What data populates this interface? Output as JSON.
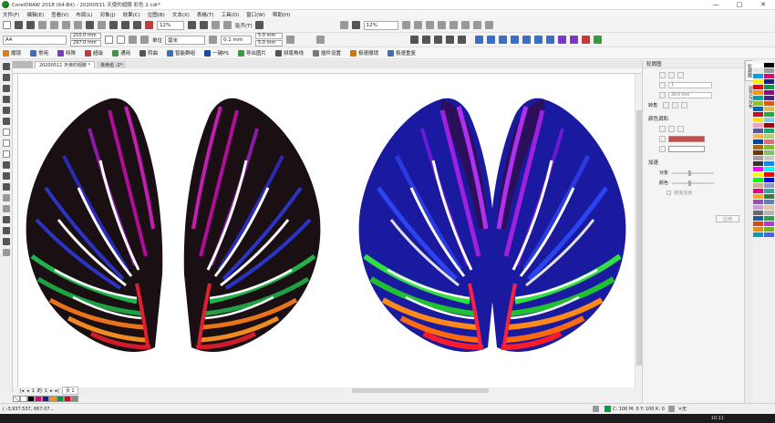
{
  "window": {
    "title": "CorelDRAW 2018 (64-Bit) - 20200511 天使的翅膀 彩色 2.cdr*",
    "minimize": "—",
    "maximize": "□",
    "close": "✕"
  },
  "menu": [
    "文件(F)",
    "编辑(E)",
    "查看(V)",
    "布局(L)",
    "对象(J)",
    "效果(C)",
    "位图(B)",
    "文本(X)",
    "表格(T)",
    "工具(O)",
    "窗口(W)",
    "帮助(H)"
  ],
  "toolbar1": {
    "zoom": "12%",
    "zoom_right": "12%",
    "snap_label": "贴齐(T)"
  },
  "toolbar2": {
    "page_size": "A4",
    "width": "210.0 mm",
    "height": "297.0 mm",
    "units_label": "单位",
    "units": "毫米",
    "nudge": "0.1 mm",
    "dup_x": "5.0 mm",
    "dup_y": "5.0 mm"
  },
  "plugins": [
    {
      "label": "魔镜",
      "icon": "mirror-icon",
      "color": "#e07a1a"
    },
    {
      "label": "常用",
      "icon": "common-icon",
      "color": "#3a6fc4"
    },
    {
      "label": "特殊",
      "icon": "special-icon",
      "color": "#7a3ac4"
    },
    {
      "label": "超级",
      "icon": "super-icon",
      "color": "#c43a3a"
    },
    {
      "label": "通用",
      "icon": "general-icon",
      "color": "#3a9b3a"
    },
    {
      "label": "转曲",
      "icon": "curve-icon",
      "color": "#555555"
    },
    {
      "label": "智能群组",
      "icon": "smart-group-icon",
      "color": "#3a6fc4"
    },
    {
      "label": "一键PS",
      "icon": "ps-icon",
      "color": "#1a4a9a"
    },
    {
      "label": "导出图片",
      "icon": "export-icon",
      "color": "#3a9b3a"
    },
    {
      "label": "拼版角线",
      "icon": "cropmark-icon",
      "color": "#555555"
    },
    {
      "label": "插件设置",
      "icon": "settings-icon",
      "color": "#777777"
    },
    {
      "label": "极速撤销",
      "icon": "undo-icon",
      "color": "#c47a1a"
    },
    {
      "label": "极速重复",
      "icon": "redo-icon",
      "color": "#3a6fc4"
    }
  ],
  "doc_tabs": {
    "active": "20200511 天使的翅膀 *",
    "other": "未命名 -2*"
  },
  "page_nav": {
    "current": "1",
    "of_label": "的",
    "total": "1",
    "page_tab": "页 1"
  },
  "status": {
    "coords": "( -3,937.537, 667.07...",
    "fill_label": "C: 100 M: 0 Y: 100 K: 0",
    "outline_label": "无",
    "clock": "10:11"
  },
  "dock": {
    "title": "轮廓图",
    "steps_value": "1",
    "offset_value": "30.0 mm",
    "corner_label": "转角",
    "color_section": "颜色调和",
    "accel_section": "加速",
    "object_label": "对象",
    "color_label": "颜色",
    "link_label": "链接加速",
    "apply": "应用",
    "outline_color": "#c0504d",
    "fill_color": "#ffffff"
  },
  "vertical_tabs": [
    "轮廓图",
    "对齐与分布"
  ],
  "swatch_colors": [
    "#ffffff",
    "#000000",
    "#e6007e",
    "#1d2088",
    "#f39800",
    "#009944",
    "#e60012",
    "#888888"
  ],
  "palette_colors": [
    "#ffffff",
    "#000000",
    "#e5e5e5",
    "#999999",
    "#00a0e9",
    "#e6007e",
    "#fff100",
    "#1d2088",
    "#e60012",
    "#009944",
    "#f39800",
    "#920783",
    "#00a29a",
    "#601986",
    "#8fc31f",
    "#ea5514",
    "#0068b7",
    "#d7c447",
    "#c30d23",
    "#22ac38",
    "#ffe100",
    "#7ecef4",
    "#f19ec2",
    "#a40000",
    "#5f52a0",
    "#13ae67",
    "#f8b551",
    "#b3d465",
    "#00479d",
    "#eb6877",
    "#ac6a00",
    "#7fbe26",
    "#6a3906",
    "#80c269",
    "#a0a0a0",
    "#c9caca",
    "#333333",
    "#0090ff",
    "#ff00ff",
    "#00ffff",
    "#ffff00",
    "#ff0000",
    "#00ff00",
    "#0000ff",
    "#d0ae86",
    "#8c97cb",
    "#e4007f",
    "#36a4a0",
    "#f5a623",
    "#3a7b3a",
    "#a04fb0",
    "#5f7fbf",
    "#c9a0dc",
    "#e2c6a1",
    "#6b6b6b",
    "#b5b5b5",
    "#1c5d99",
    "#2f9e44",
    "#d9480f",
    "#ae3ec9",
    "#f08c00",
    "#74b816",
    "#1098ad",
    "#4263eb"
  ]
}
